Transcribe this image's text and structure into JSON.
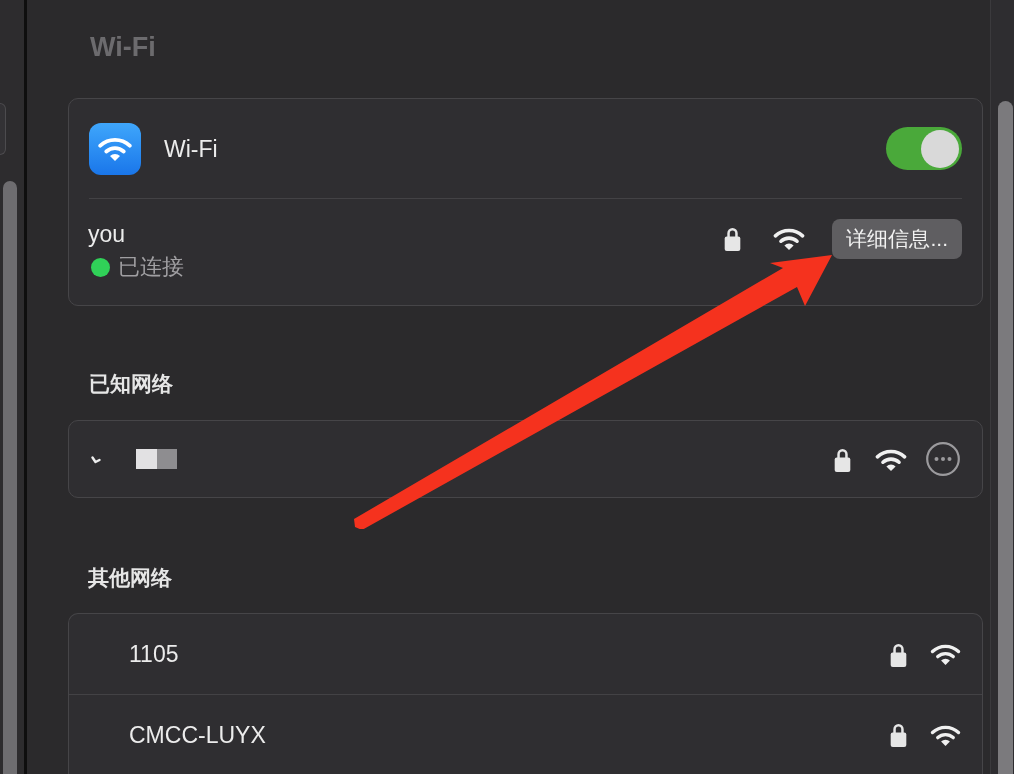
{
  "page_title": "Wi-Fi",
  "wifi_card": {
    "label": "Wi-Fi",
    "on": true,
    "current_network": {
      "name": "you",
      "connected": true,
      "status": "已连接",
      "secured": true,
      "details_button": "详细信息..."
    }
  },
  "known_networks": {
    "heading": "已知网络",
    "items": [
      {
        "connected": true,
        "secured": true
      }
    ]
  },
  "other_networks": {
    "heading": "其他网络",
    "items": [
      {
        "name": "1105",
        "secured": true
      },
      {
        "name": "CMCC-LUYX",
        "secured": true
      }
    ]
  }
}
